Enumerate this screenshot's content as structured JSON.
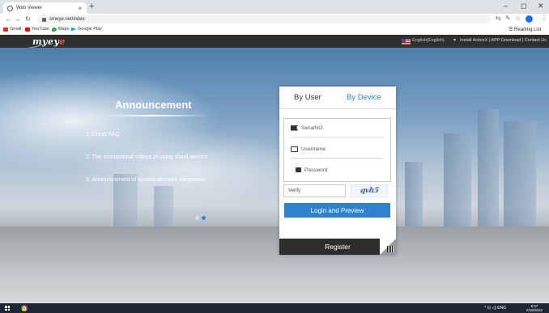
{
  "browser": {
    "tab_title": "Web Viewer",
    "tab_close": "×",
    "new_tab": "+",
    "url": "smeye.net/index",
    "bookmarks": [
      {
        "label": "Gmail",
        "color": "#d93025"
      },
      {
        "label": "YouTube",
        "color": "#ff0000"
      },
      {
        "label": "Maps",
        "color": "#34a853"
      },
      {
        "label": "Google Play",
        "color": "#00a2ff"
      }
    ],
    "reading_list": "Reading List",
    "window_controls": {
      "minimize": "–",
      "maximize": "◻",
      "close": "✕"
    }
  },
  "site": {
    "logo_prefix": "myeye",
    "logo_main": "myey",
    "logo_accent": "e",
    "language": "English(English)",
    "language_caret": "▾",
    "top_links": "Install ActiveX  |  APP Download  |  Contact Us"
  },
  "announcement": {
    "title": "Announcement",
    "items": [
      "1. Cloud FAQ",
      "2. The instructional videos of using cloud service",
      "3. Announcement of system account integration"
    ]
  },
  "login": {
    "tabs": {
      "by_user": "By User",
      "by_device": "By Device"
    },
    "serial_placeholder": "SerialNO.",
    "username_placeholder": "Username",
    "password_placeholder": "Password",
    "verify_placeholder": "Verify",
    "captcha_text": "qvh5",
    "login_button": "Login and Preview",
    "register_button": "Register"
  },
  "taskbar": {
    "tray_text": "^  ⊡  ◁)  ENG",
    "time": "8:47",
    "date": "2/18/2022"
  },
  "colors": {
    "accent_blue": "#2f82cf",
    "header_dark": "#2f2f2f",
    "logo_orange": "#ff5a3c"
  }
}
